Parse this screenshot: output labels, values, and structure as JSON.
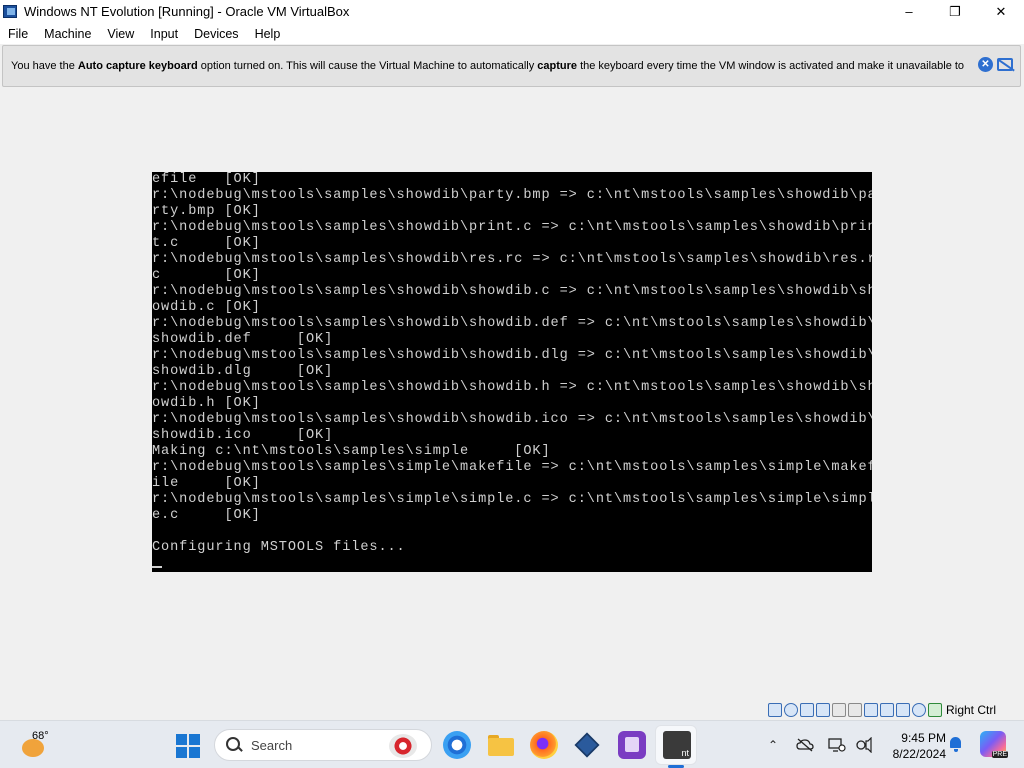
{
  "window": {
    "title": "Windows NT Evolution [Running] - Oracle VM VirtualBox",
    "controls": {
      "minimize": "–",
      "maximize": "❐",
      "close": "✕"
    }
  },
  "menu": {
    "items": [
      "File",
      "Machine",
      "View",
      "Input",
      "Devices",
      "Help"
    ]
  },
  "banner": {
    "text_before": "You have the ",
    "bold1": "Auto capture keyboard",
    "text_mid": " option turned on. This will cause the Virtual Machine to automatically ",
    "bold2": "capture",
    "text_after": " the keyboard every time the VM window is activated and make it unavailable to"
  },
  "console": {
    "lines": [
      "efile   [OK]",
      "r:\\nodebug\\mstools\\samples\\showdib\\party.bmp => c:\\nt\\mstools\\samples\\showdib\\pa",
      "rty.bmp [OK]",
      "r:\\nodebug\\mstools\\samples\\showdib\\print.c => c:\\nt\\mstools\\samples\\showdib\\prin",
      "t.c     [OK]",
      "r:\\nodebug\\mstools\\samples\\showdib\\res.rc => c:\\nt\\mstools\\samples\\showdib\\res.r",
      "c       [OK]",
      "r:\\nodebug\\mstools\\samples\\showdib\\showdib.c => c:\\nt\\mstools\\samples\\showdib\\sh",
      "owdib.c [OK]",
      "r:\\nodebug\\mstools\\samples\\showdib\\showdib.def => c:\\nt\\mstools\\samples\\showdib\\",
      "showdib.def     [OK]",
      "r:\\nodebug\\mstools\\samples\\showdib\\showdib.dlg => c:\\nt\\mstools\\samples\\showdib\\",
      "showdib.dlg     [OK]",
      "r:\\nodebug\\mstools\\samples\\showdib\\showdib.h => c:\\nt\\mstools\\samples\\showdib\\sh",
      "owdib.h [OK]",
      "r:\\nodebug\\mstools\\samples\\showdib\\showdib.ico => c:\\nt\\mstools\\samples\\showdib\\",
      "showdib.ico     [OK]",
      "Making c:\\nt\\mstools\\samples\\simple     [OK]",
      "r:\\nodebug\\mstools\\samples\\simple\\makefile => c:\\nt\\mstools\\samples\\simple\\makef",
      "ile     [OK]",
      "r:\\nodebug\\mstools\\samples\\simple\\simple.c => c:\\nt\\mstools\\samples\\simple\\simpl",
      "e.c     [OK]",
      "",
      "Configuring MSTOOLS files..."
    ]
  },
  "statusbar": {
    "host_key": "Right Ctrl",
    "icons": [
      "hard-disk-icon",
      "optical-drive-icon",
      "audio-icon",
      "network-icon",
      "usb-icon",
      "shared-folders-icon",
      "display-icon",
      "video-capture-icon",
      "recording-icon",
      "mouse-integration-icon",
      "keyboard-icon"
    ]
  },
  "taskbar": {
    "weather_temp": "68°",
    "search_label": "Search",
    "tray": {
      "chevron": "⌃"
    },
    "clock_time": "9:45 PM",
    "clock_date": "8/22/2024",
    "copilot_badge": "PRE"
  }
}
